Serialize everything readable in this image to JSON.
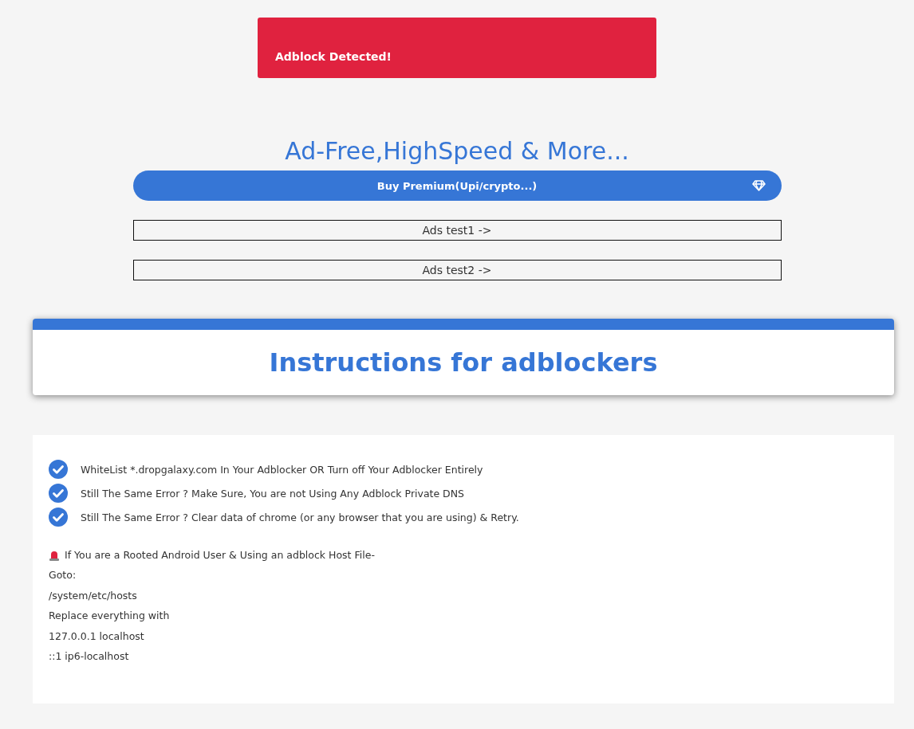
{
  "alert": {
    "text": "Adblock Detected!"
  },
  "headline": "Ad-Free,HighSpeed & More...",
  "premium_button": {
    "label": "Buy Premium(Upi/crypto...)"
  },
  "ad_links": [
    "Ads test1 ->",
    "Ads test2 ->"
  ],
  "instructions_title": "Instructions for adblockers",
  "checklist": [
    "WhiteList *.dropgalaxy.com In Your Adblocker OR Turn off Your Adblocker Entirely",
    "Still The Same Error ? Make Sure, You are not Using Any Adblock Private DNS",
    "Still The Same Error ? Clear data of chrome (or any browser that you are using) & Retry."
  ],
  "root_note": "If You are a Rooted Android User & Using an adblock Host File-",
  "root_steps": [
    "Goto:",
    "/system/etc/hosts",
    "Replace everything with",
    "127.0.0.1 localhost",
    "::1 ip6-localhost"
  ]
}
